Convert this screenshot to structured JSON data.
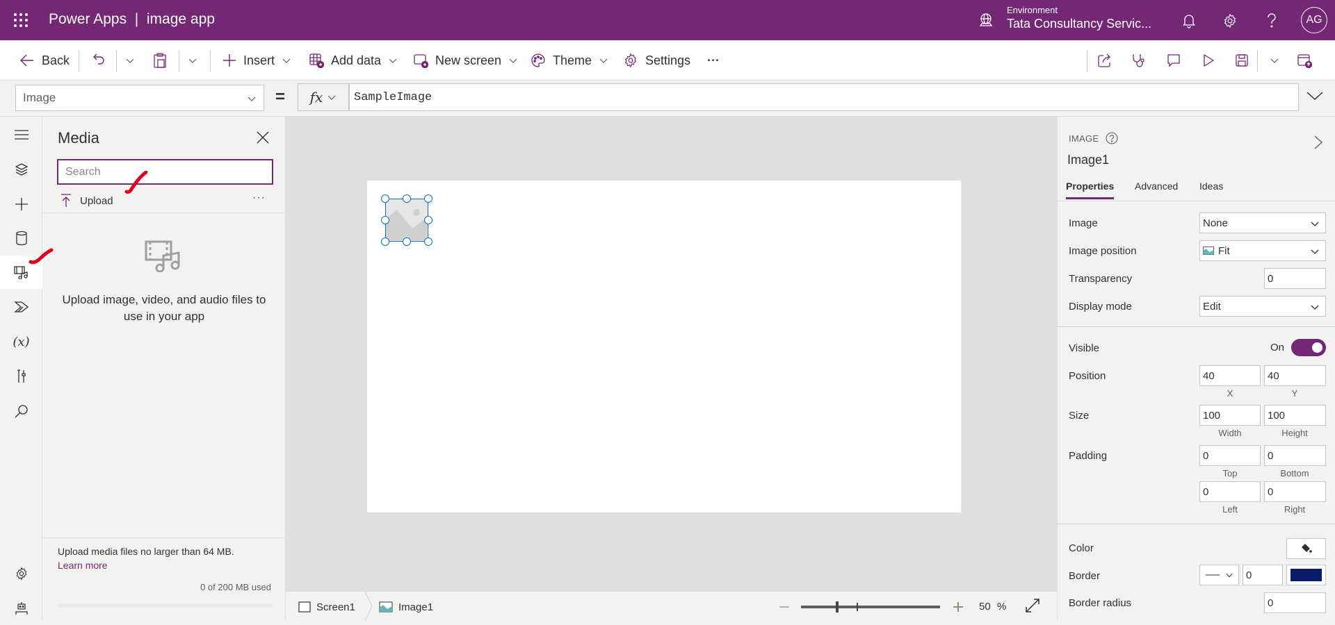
{
  "header": {
    "app_title": "Power Apps  |  image app",
    "environment_label": "Environment",
    "environment_name": "Tata Consultancy Servic...",
    "avatar_initials": "AG",
    "icons": [
      "waffle-icon",
      "environment-icon",
      "bell-icon",
      "gear-icon",
      "help-icon"
    ]
  },
  "toolbar": {
    "back": "Back",
    "insert": "Insert",
    "add_data": "Add data",
    "new_screen": "New screen",
    "theme": "Theme",
    "settings": "Settings",
    "more": "···",
    "right_icons": [
      "share-icon",
      "app-checker-icon",
      "comments-icon",
      "preview-play-icon",
      "save-icon",
      "save-options-chevron",
      "publish-icon"
    ]
  },
  "formula_bar": {
    "property": "Image",
    "equals": "=",
    "fx": "fx",
    "formula": "SampleImage"
  },
  "left_rail": {
    "items": [
      "menu",
      "tree-view",
      "insert",
      "data",
      "media",
      "power-automate",
      "variables",
      "advanced-tools",
      "search",
      "settings",
      "virtual-agent"
    ],
    "active": "media"
  },
  "media_panel": {
    "title": "Media",
    "search_placeholder": "Search",
    "search_value": "",
    "upload_label": "Upload",
    "more": "···",
    "empty_text": "Upload image, video, and audio files to use in your app",
    "limit_text": "Upload media files no larger than 64 MB.",
    "learn_more": "Learn more",
    "usage_text": "0 of 200 MB used",
    "usage_fraction": 0
  },
  "status_bar": {
    "breadcrumb": [
      "Screen1",
      "Image1"
    ],
    "zoom_value": "50",
    "zoom_unit": "%"
  },
  "properties_panel": {
    "control_type": "IMAGE",
    "control_name": "Image1",
    "tabs": [
      "Properties",
      "Advanced",
      "Ideas"
    ],
    "active_tab": "Properties",
    "image_label": "Image",
    "image_value": "None",
    "image_position_label": "Image position",
    "image_position_value": "Fit",
    "transparency_label": "Transparency",
    "transparency_value": "0",
    "display_mode_label": "Display mode",
    "display_mode_value": "Edit",
    "visible_label": "Visible",
    "visible_state": "On",
    "position_label": "Position",
    "position_x": "40",
    "position_y": "40",
    "x_label": "X",
    "y_label": "Y",
    "size_label": "Size",
    "width_value": "100",
    "height_value": "100",
    "width_label": "Width",
    "height_label": "Height",
    "padding_label": "Padding",
    "padding_top": "0",
    "padding_bottom": "0",
    "padding_left": "0",
    "padding_right": "0",
    "top_label": "Top",
    "bottom_label": "Bottom",
    "left_label": "Left",
    "right_label": "Right",
    "color_label": "Color",
    "border_label": "Border",
    "border_width": "0",
    "border_color": "#0b1b6b",
    "border_radius_label": "Border radius",
    "border_radius_value": "0"
  },
  "colors": {
    "brand": "#742774",
    "selection": "#0f6cbd",
    "annotation": "#e0001b"
  }
}
